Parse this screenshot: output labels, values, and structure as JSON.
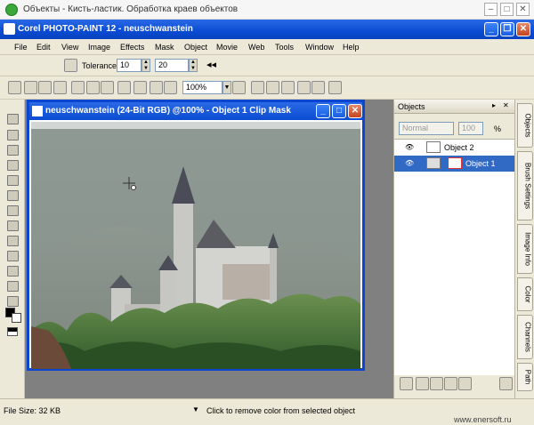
{
  "outer_window": {
    "title": "Объекты - Кисть-ластик. Обработка краев объектов",
    "min_label": "–",
    "max_label": "□",
    "close_label": "✕"
  },
  "app": {
    "title": "Corel PHOTO-PAINT 12 - neuschwanstein",
    "min_label": "_",
    "max_label": "❐",
    "close_label": "✕"
  },
  "menu": [
    "File",
    "Edit",
    "View",
    "Image",
    "Effects",
    "Mask",
    "Object",
    "Movie",
    "Web",
    "Tools",
    "Window",
    "Help"
  ],
  "property_bar": {
    "tolerance_label": "Tolerance",
    "tolerance_value": "10",
    "tolerance_value2": "20"
  },
  "standard_bar": {
    "zoom_value": "100%"
  },
  "image_window": {
    "title": "neuschwanstein (24-Bit RGB) @100% - Object 1 Clip Mask",
    "min_label": "_",
    "max_label": "□",
    "close_label": "✕"
  },
  "objects_panel": {
    "title": "Objects",
    "merge_mode": "Normal",
    "opacity": "100",
    "opacity_unit": "%",
    "objects": [
      {
        "name": "Object 2",
        "selected": false
      },
      {
        "name": "Object 1",
        "selected": true
      }
    ]
  },
  "side_tabs": [
    "Objects",
    "Brush Settings",
    "Image Info",
    "Color",
    "Channels",
    "Path"
  ],
  "status": {
    "file_size": "File Size: 32 KB",
    "hint": "Click to remove color from selected object",
    "watermark": "www.enersoft.ru"
  },
  "colors": {
    "xp_blue": "#0a4bd2",
    "selection_blue": "#316ac5",
    "panel_bg": "#ece9d8"
  }
}
